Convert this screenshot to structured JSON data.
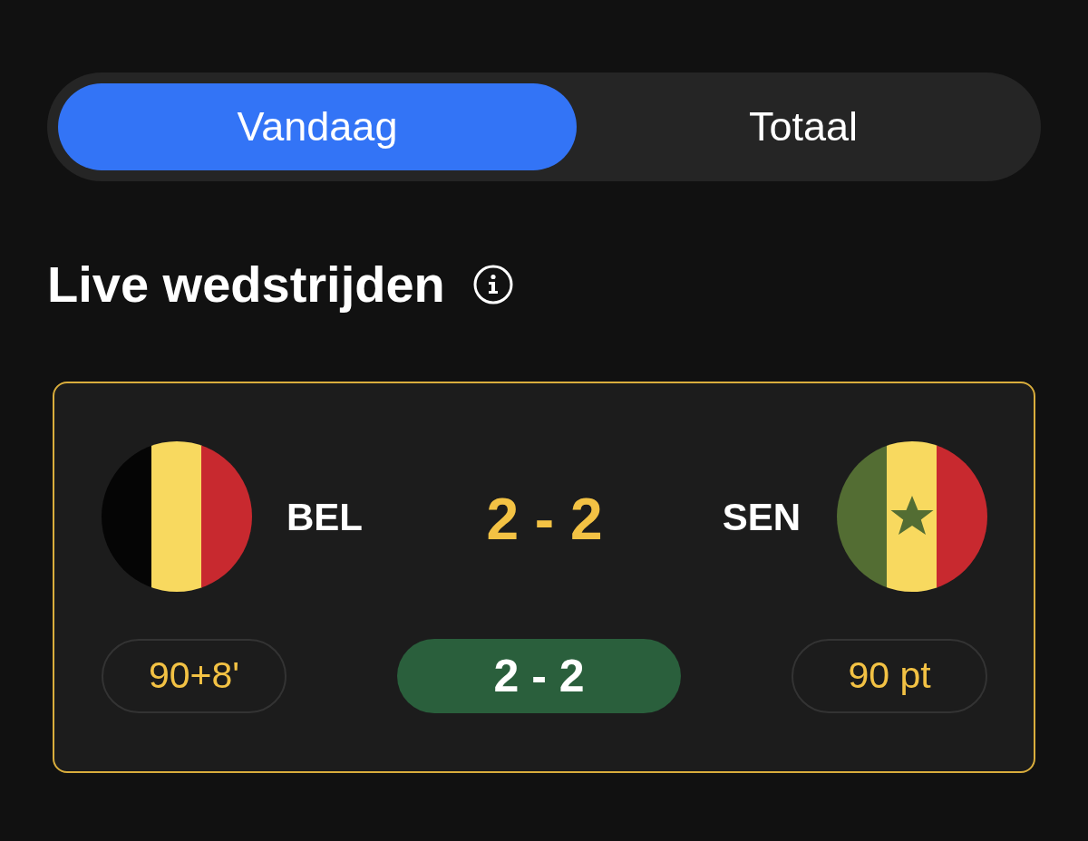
{
  "tabs": [
    {
      "label": "Vandaag",
      "selected": true
    },
    {
      "label": "Totaal",
      "selected": false
    }
  ],
  "section": {
    "title": "Live wedstrijden"
  },
  "match": {
    "teams": [
      {
        "code": "BEL"
      },
      {
        "code": "SEN"
      }
    ],
    "score": "2 - 2",
    "minute": "90+8'",
    "prediction": "2 - 2",
    "points": "90 pt"
  }
}
